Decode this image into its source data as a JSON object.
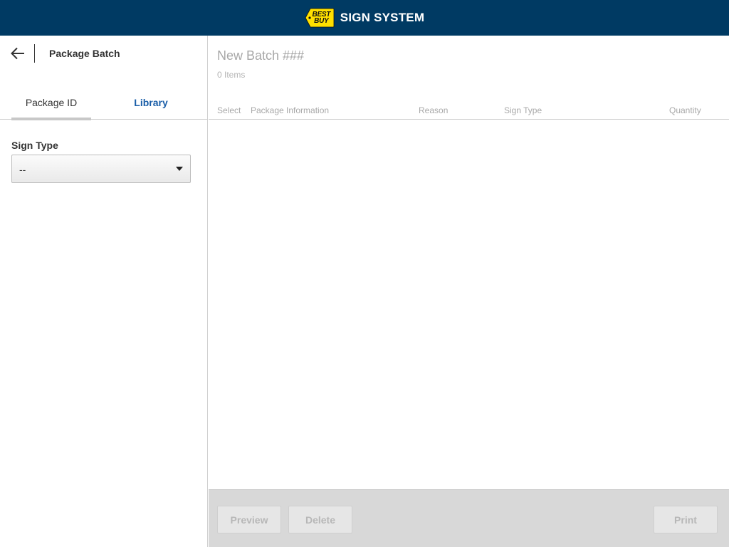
{
  "header": {
    "logo_text_line1": "BEST",
    "logo_text_line2": "BUY",
    "app_title": "SIGN SYSTEM",
    "bar_color": "#003a63",
    "logo_color": "#ffe000"
  },
  "sidebar": {
    "page_title": "Package Batch",
    "tabs": [
      {
        "label": "Package ID",
        "active": true
      },
      {
        "label": "Library",
        "active": false
      }
    ],
    "sign_type": {
      "label": "Sign Type",
      "selected": "--"
    }
  },
  "main": {
    "batch_title": "New Batch ###",
    "item_count": "0 Items",
    "columns": [
      "Select",
      "Package Information",
      "Reason",
      "Sign Type",
      "Quantity"
    ],
    "rows": []
  },
  "footer": {
    "preview_label": "Preview",
    "delete_label": "Delete",
    "print_label": "Print"
  }
}
